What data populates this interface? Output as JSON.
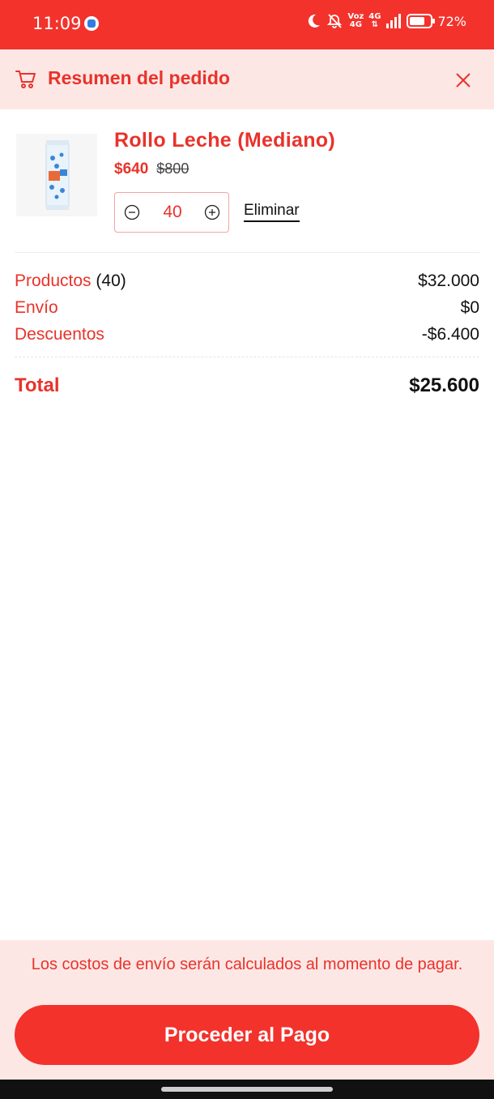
{
  "status_bar": {
    "time": "11:09",
    "network_top": "Voz",
    "network_bottom": "4G",
    "network_type_top": "4G",
    "network_type_bottom": "4G",
    "battery_percent": "72%",
    "battery_level": 0.72,
    "background": "#f3322c"
  },
  "header": {
    "title": "Resumen del pedido",
    "icon": "cart-icon",
    "close_icon": "close-icon",
    "background": "#fde7e5"
  },
  "product": {
    "name": "Rollo Leche (Mediano)",
    "price": "$640",
    "original_price": "$800",
    "quantity": "40",
    "remove_label": "Eliminar"
  },
  "summary": {
    "products_label": "Productos",
    "products_count": "(40)",
    "products_value": "$32.000",
    "shipping_label": "Envío",
    "shipping_value": "$0",
    "discounts_label": "Descuentos",
    "discounts_value": "-$6.400",
    "total_label": "Total",
    "total_value": "$25.600"
  },
  "footer": {
    "note": "Los costos de envío serán calculados al momento de pagar.",
    "button_label": "Proceder al Pago"
  },
  "colors": {
    "accent": "#e8332b",
    "button": "#f3322c",
    "panel": "#fde7e5"
  }
}
